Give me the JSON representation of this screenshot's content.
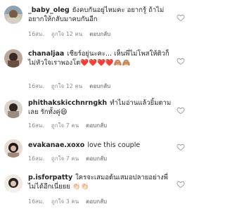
{
  "colors": {
    "text": "#262626",
    "meta": "#8e8e8e",
    "heart_outline": "#9a9a9a",
    "emoji_heart": "#ed4956"
  },
  "comments": [
    {
      "username": "_baby_oleg",
      "text": "ยังคบกันอยู่ไหมคะ อยากรู้ ถ้าไม่อยากให้กลับมาคบกันอีก",
      "time": "16สม.",
      "likes": "ถูกใจ 12 คน",
      "reply": "ตอบกลับ",
      "avatar_icon": "avatar-photo-icon"
    },
    {
      "username": "chanaljaa",
      "text": "เชียร์อยู่นะคะ... เห็นพี่ไม่โพสให้ติวก็ไม่หัวใจเราพองโต❤️❤️❤️❤️🙈🙈",
      "time": "16สม.",
      "likes": "ถูกใจ 12 คน",
      "reply": "ตอบกลับ",
      "avatar_icon": "avatar-photo-icon"
    },
    {
      "username": "phithakskicchnrngkh",
      "text": "ทำไมอ่านแล้วยิ้มตามเลย รักทั้งคู่😄",
      "time": "16สม.",
      "likes": "ถูกใจ 7 คน",
      "reply": "ตอบกลับ",
      "avatar_icon": "avatar-photo-icon"
    },
    {
      "username": "evakanae.xoxo",
      "text": "love this couple",
      "time": "16สม.",
      "likes": "ถูกใจ 7 คน",
      "reply": "ตอบกลับ",
      "avatar_icon": "avatar-photo-icon"
    },
    {
      "username": "p.isforpatty",
      "text": "ใครจะเสมอต้นเสมอปลายอย่างพี่ไม่ได้อีกเนี่ยยย 👏🏻👏🏻",
      "time": "16สม.",
      "likes": "ถูกใจ 3 คน",
      "reply": "ตอบกลับ",
      "avatar_icon": "avatar-photo-icon"
    }
  ]
}
